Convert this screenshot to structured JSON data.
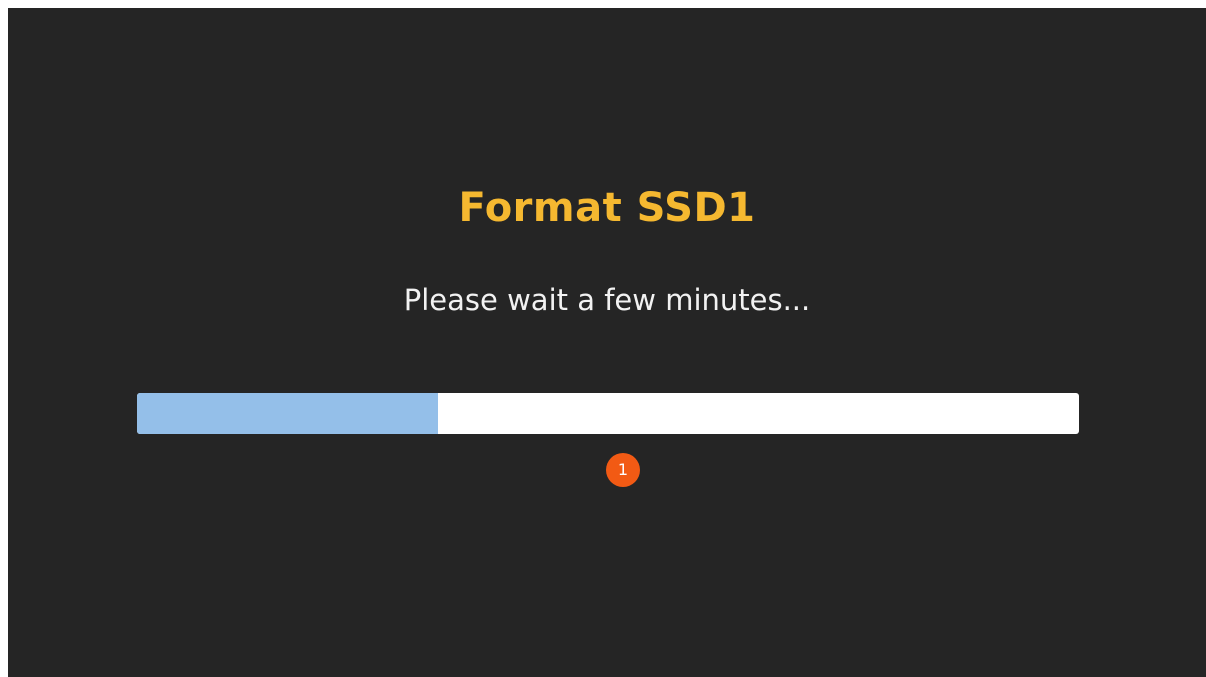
{
  "dialog": {
    "title": "Format SSD1",
    "message": "Please wait a few minutes...",
    "progress": 0.32,
    "callout_number": "1"
  },
  "colors": {
    "background": "#252525",
    "title": "#f5b830",
    "progress_fill": "#94bfe9",
    "progress_track": "#ffffff",
    "callout": "#f25a14"
  }
}
